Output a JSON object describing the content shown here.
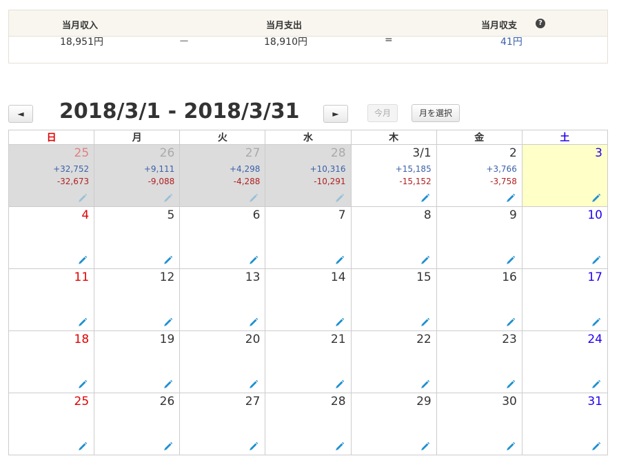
{
  "summary": {
    "income_label": "当月収入",
    "expense_label": "当月支出",
    "balance_label": "当月収支",
    "income_value": "18,951円",
    "minus_sign": "ー",
    "expense_value": "18,910円",
    "equals_sign": "=",
    "balance_value": "41円",
    "help_icon": "?"
  },
  "nav": {
    "prev_label": "◄",
    "title": "2018/3/1 - 2018/3/31",
    "next_label": "►",
    "today_label": "今月",
    "select_month_label": "月を選択"
  },
  "weekdays": [
    "日",
    "月",
    "火",
    "水",
    "木",
    "金",
    "土"
  ],
  "weeks": [
    [
      {
        "day": "25",
        "income": "+32,752",
        "expense": "-32,673",
        "other": true
      },
      {
        "day": "26",
        "income": "+9,111",
        "expense": "-9,088",
        "other": true
      },
      {
        "day": "27",
        "income": "+4,298",
        "expense": "-4,288",
        "other": true
      },
      {
        "day": "28",
        "income": "+10,316",
        "expense": "-10,291",
        "other": true
      },
      {
        "day": "3/1",
        "income": "+15,185",
        "expense": "-15,152"
      },
      {
        "day": "2",
        "income": "+3,766",
        "expense": "-3,758"
      },
      {
        "day": "3",
        "today": true
      }
    ],
    [
      {
        "day": "4"
      },
      {
        "day": "5"
      },
      {
        "day": "6"
      },
      {
        "day": "7"
      },
      {
        "day": "8"
      },
      {
        "day": "9"
      },
      {
        "day": "10"
      }
    ],
    [
      {
        "day": "11"
      },
      {
        "day": "12"
      },
      {
        "day": "13"
      },
      {
        "day": "14"
      },
      {
        "day": "15"
      },
      {
        "day": "16"
      },
      {
        "day": "17"
      }
    ],
    [
      {
        "day": "18"
      },
      {
        "day": "19"
      },
      {
        "day": "20"
      },
      {
        "day": "21"
      },
      {
        "day": "22"
      },
      {
        "day": "23"
      },
      {
        "day": "24"
      }
    ],
    [
      {
        "day": "25"
      },
      {
        "day": "26"
      },
      {
        "day": "27"
      },
      {
        "day": "28"
      },
      {
        "day": "29"
      },
      {
        "day": "30"
      },
      {
        "day": "31"
      }
    ]
  ],
  "colors": {
    "sunday": "#e00000",
    "saturday": "#2200ee",
    "income": "#3a60a8",
    "expense": "#b02020",
    "pencil": "#1f8fd0",
    "other_month_bg": "#dcdcdc",
    "today_bg": "#ffffc8"
  },
  "icons": {
    "edit": "pencil-icon",
    "help": "question-circle-icon"
  }
}
